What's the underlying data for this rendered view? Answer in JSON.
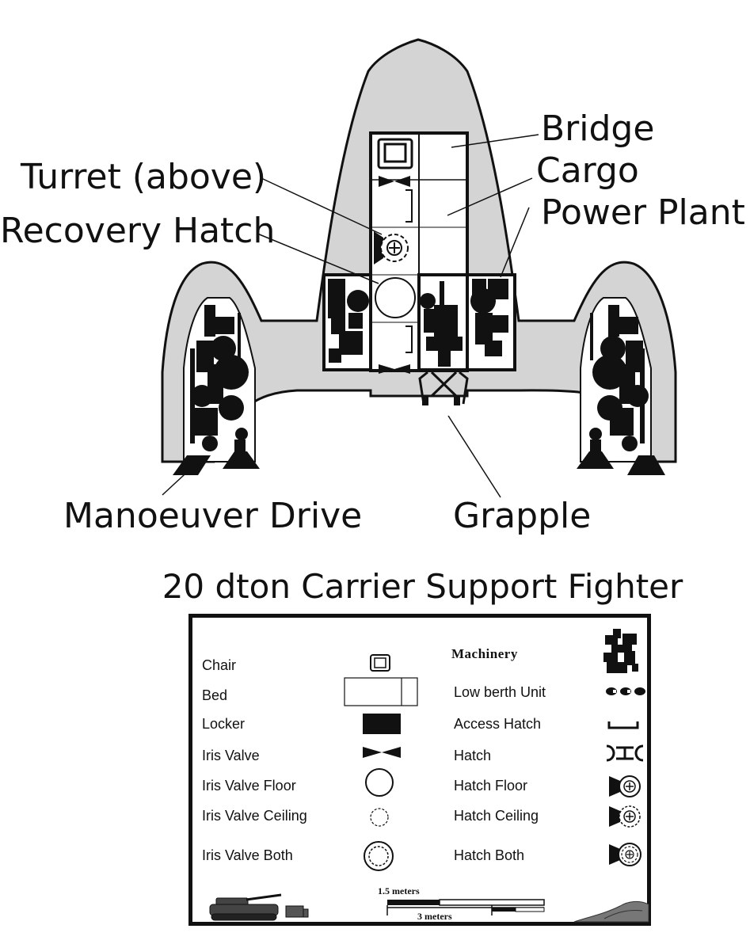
{
  "callouts": {
    "bridge": "Bridge",
    "cargo": "Cargo",
    "power_plant": "Power Plant",
    "turret": "Turret (above)",
    "recovery_hatch": "Recovery Hatch",
    "manoeuver_drive": "Manoeuver Drive",
    "grapple": "Grapple"
  },
  "title": "20 dton Carrier Support Fighter",
  "legend": {
    "left": [
      {
        "label": "Chair",
        "icon": "chair-icon"
      },
      {
        "label": "Bed",
        "icon": "bed-icon"
      },
      {
        "label": "Locker",
        "icon": "locker-icon"
      },
      {
        "label": "Iris Valve",
        "icon": "iris-valve-icon"
      },
      {
        "label": "Iris Valve Floor",
        "icon": "iris-valve-floor-icon"
      },
      {
        "label": "Iris Valve Ceiling",
        "icon": "iris-valve-ceiling-icon"
      },
      {
        "label": "Iris Valve Both",
        "icon": "iris-valve-both-icon"
      }
    ],
    "right": [
      {
        "label": "Machinery",
        "icon": "machinery-icon"
      },
      {
        "label": "Low berth Unit",
        "icon": "low-berth-icon"
      },
      {
        "label": "Access Hatch",
        "icon": "access-hatch-icon"
      },
      {
        "label": "Hatch",
        "icon": "hatch-icon"
      },
      {
        "label": "Hatch Floor",
        "icon": "hatch-floor-icon"
      },
      {
        "label": "Hatch Ceiling",
        "icon": "hatch-ceiling-icon"
      },
      {
        "label": "Hatch Both",
        "icon": "hatch-both-icon"
      }
    ],
    "scale_small": "1.5 meters",
    "scale_large": "3 meters"
  },
  "colors": {
    "hull": "#d4d4d4",
    "ink": "#111111",
    "room": "#ffffff"
  }
}
